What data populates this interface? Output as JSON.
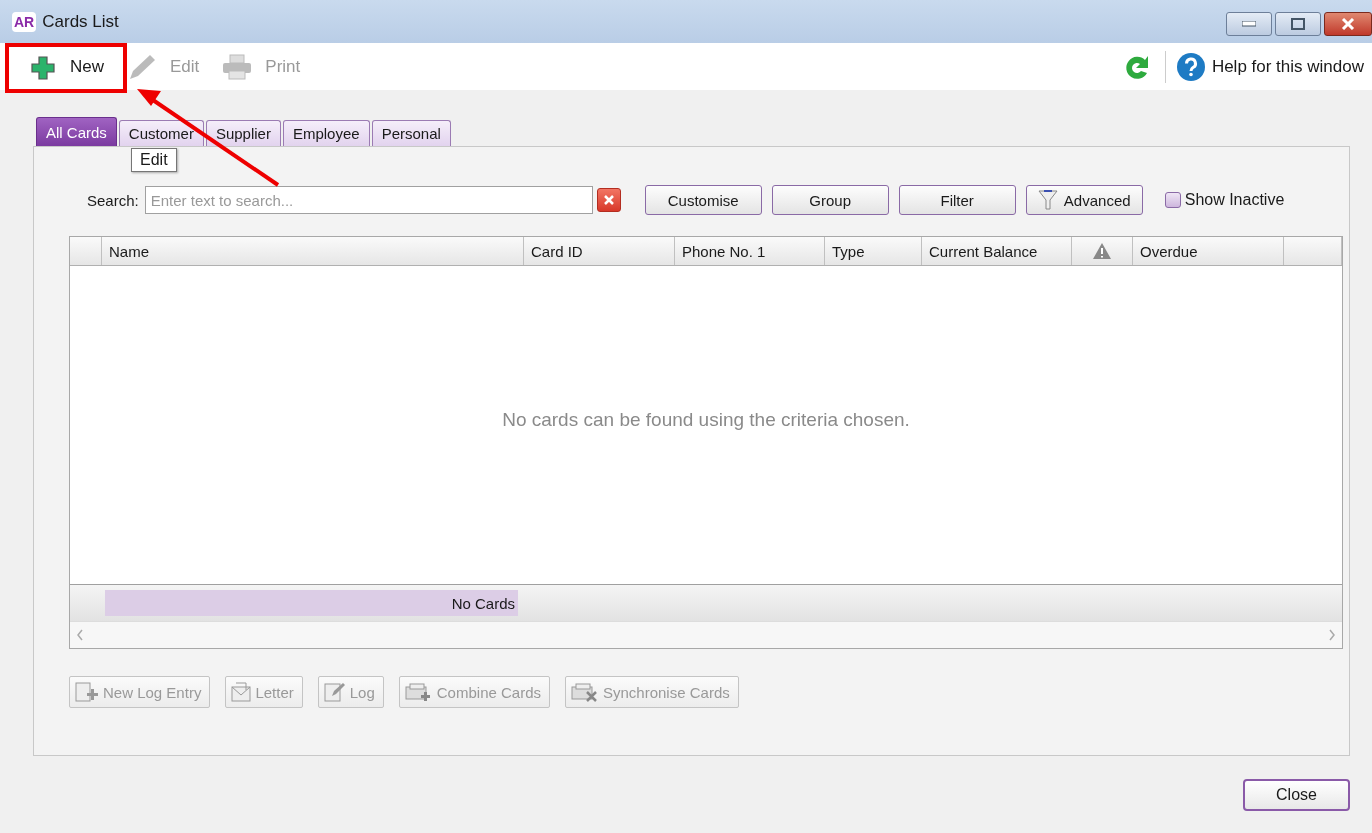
{
  "window": {
    "title": "Cards List",
    "app_badge": "AR"
  },
  "toolbar": [
    {
      "label": "New",
      "kind": "new",
      "disabled": false
    },
    {
      "label": "Edit",
      "kind": "edit",
      "disabled": true
    },
    {
      "label": "Print",
      "kind": "print",
      "disabled": true
    }
  ],
  "help": {
    "label": "Help for this window"
  },
  "tabs": [
    {
      "label": "All Cards",
      "selected": true
    },
    {
      "label": "Customer",
      "selected": false
    },
    {
      "label": "Supplier",
      "selected": false
    },
    {
      "label": "Employee",
      "selected": false
    },
    {
      "label": "Personal",
      "selected": false
    }
  ],
  "tooltip": "Edit",
  "search": {
    "label": "Search:",
    "placeholder": "Enter text to search..."
  },
  "filter_buttons": [
    {
      "label": "Customise",
      "kind": "plain"
    },
    {
      "label": "Group",
      "kind": "plain"
    },
    {
      "label": "Filter",
      "kind": "plain"
    },
    {
      "label": "Advanced",
      "kind": "funnel"
    }
  ],
  "show_inactive": {
    "label": "Show Inactive",
    "checked": false
  },
  "table": {
    "columns": [
      {
        "label": "Name",
        "kind": "text"
      },
      {
        "label": "Card ID",
        "kind": "text"
      },
      {
        "label": "Phone No. 1",
        "kind": "text"
      },
      {
        "label": "Type",
        "kind": "text"
      },
      {
        "label": "Current Balance",
        "kind": "text"
      },
      {
        "kind": "warning"
      },
      {
        "label": "Overdue",
        "kind": "text"
      }
    ],
    "empty_message": "No cards can be found using the criteria chosen.",
    "footer": "No Cards"
  },
  "actions": [
    {
      "label": "New Log Entry",
      "kind": "log-entry",
      "disabled": true
    },
    {
      "label": "Letter",
      "kind": "letter",
      "disabled": true
    },
    {
      "label": "Log",
      "kind": "log",
      "disabled": true
    },
    {
      "label": "Combine Cards",
      "kind": "combine",
      "disabled": true
    },
    {
      "label": "Synchronise Cards",
      "kind": "sync",
      "disabled": true
    }
  ],
  "close_button": "Close"
}
